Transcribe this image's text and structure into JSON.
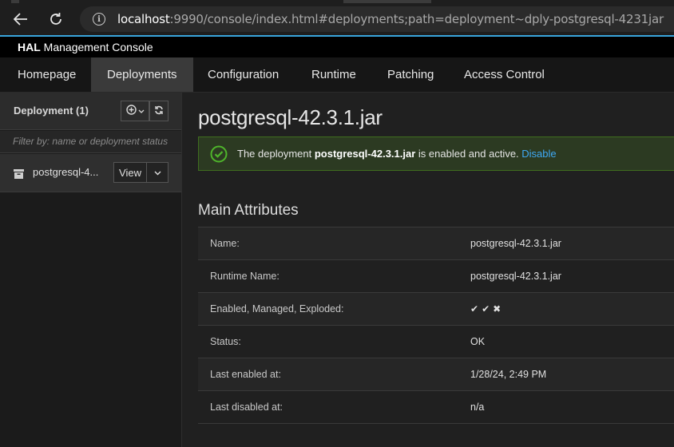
{
  "browser": {
    "url_host": "localhost",
    "url_rest": ":9990/console/index.html#deployments;path=deployment~dply-postgresql-4231jar",
    "icons": {
      "back": "back-arrow-icon",
      "reload": "reload-icon",
      "info": "info-icon"
    }
  },
  "app": {
    "brand": "HAL",
    "title_rest": "Management Console"
  },
  "nav": {
    "tabs": [
      {
        "label": "Homepage"
      },
      {
        "label": "Deployments",
        "active": true
      },
      {
        "label": "Configuration"
      },
      {
        "label": "Runtime"
      },
      {
        "label": "Patching"
      },
      {
        "label": "Access Control"
      }
    ]
  },
  "sidebar": {
    "title": "Deployment (1)",
    "filter_placeholder": "Filter by: name or deployment status",
    "items": [
      {
        "name": "postgresql-4...",
        "view_label": "View"
      }
    ]
  },
  "main": {
    "title": "postgresql-42.3.1.jar",
    "alert": {
      "prefix": "The deployment ",
      "name": "postgresql-42.3.1.jar",
      "suffix": " is enabled and active. ",
      "link": "Disable"
    },
    "section_title": "Main Attributes",
    "attributes": [
      {
        "label": "Name:",
        "value": "postgresql-42.3.1.jar"
      },
      {
        "label": "Runtime Name:",
        "value": "postgresql-42.3.1.jar"
      },
      {
        "label": "Enabled, Managed, Exploded:",
        "flags": [
          "✔",
          "✔",
          "✖"
        ]
      },
      {
        "label": "Status:",
        "value": "OK"
      },
      {
        "label": "Last enabled at:",
        "value": "1/28/24, 2:49 PM"
      },
      {
        "label": "Last disabled at:",
        "value": "n/a"
      }
    ]
  },
  "colors": {
    "accent": "#39a5dc",
    "success_border": "#3f6d1f",
    "success_bg": "#2c3a22",
    "link": "#3fa9f5"
  }
}
